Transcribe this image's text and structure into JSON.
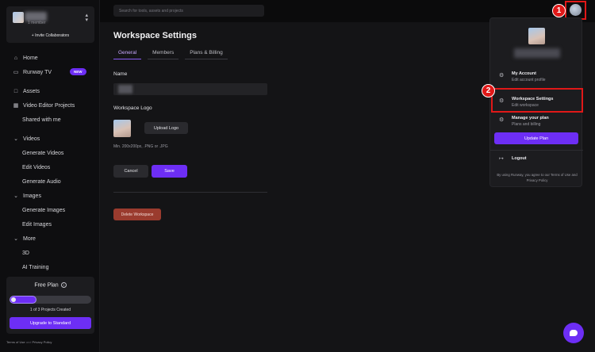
{
  "workspace": {
    "members": "1 member",
    "invite_label": "+ Invite Collaborators"
  },
  "sidebar": {
    "items": [
      {
        "label": "Home",
        "icon": "home-icon"
      },
      {
        "label": "Runway TV",
        "icon": "tv-icon",
        "badge": "NEW"
      },
      {
        "label": "Assets",
        "icon": "folder-icon"
      },
      {
        "label": "Video Editor Projects",
        "icon": "video-editor-icon"
      },
      {
        "label": "Shared with me"
      },
      {
        "label": "Videos",
        "icon": "chevron-down-icon"
      },
      {
        "label": "Generate Videos"
      },
      {
        "label": "Edit Videos"
      },
      {
        "label": "Generate Audio"
      },
      {
        "label": "Images",
        "icon": "chevron-down-icon"
      },
      {
        "label": "Generate Images"
      },
      {
        "label": "Edit Images"
      },
      {
        "label": "More",
        "icon": "chevron-down-icon"
      },
      {
        "label": "3D"
      },
      {
        "label": "AI Training"
      }
    ]
  },
  "plan": {
    "title": "Free Plan",
    "projects_used": 1,
    "projects_total": 3,
    "count_text": "1 of 3 Projects Created",
    "upgrade_label": "Upgrade to Standard"
  },
  "footer": {
    "terms": "Terms of Use",
    "and": "and",
    "privacy": "Privacy Policy"
  },
  "search": {
    "placeholder": "Search for tools, assets and projects"
  },
  "settings": {
    "title": "Workspace Settings",
    "tabs": [
      "General",
      "Members",
      "Plans & Billing"
    ],
    "active_tab": "General",
    "name_label": "Name",
    "logo_label": "Workspace Logo",
    "upload_label": "Upload Logo",
    "logo_hint": "Min. 200x200px, .PNG or .JPG",
    "cancel_label": "Cancel",
    "save_label": "Save",
    "delete_label": "Delete Workspace"
  },
  "dropdown": {
    "items": [
      {
        "title": "My Account",
        "subtitle": "Edit account profile",
        "icon": "gear-icon"
      },
      {
        "title": "Workspace Settings",
        "subtitle": "Edit workspace",
        "icon": "gear-icon"
      },
      {
        "title": "Manage your plan",
        "subtitle": "Plans and billing",
        "icon": "gear-icon"
      }
    ],
    "update_label": "Update Plan",
    "logout_label": "Logout",
    "terms_text": "By using Runway, you agree to our Terms of Use and Privacy Policy"
  },
  "annotations": {
    "step1": "1",
    "step2": "2"
  },
  "colors": {
    "accent": "#6d2ef5",
    "danger": "#9a3b2e",
    "marker": "#e01818"
  }
}
